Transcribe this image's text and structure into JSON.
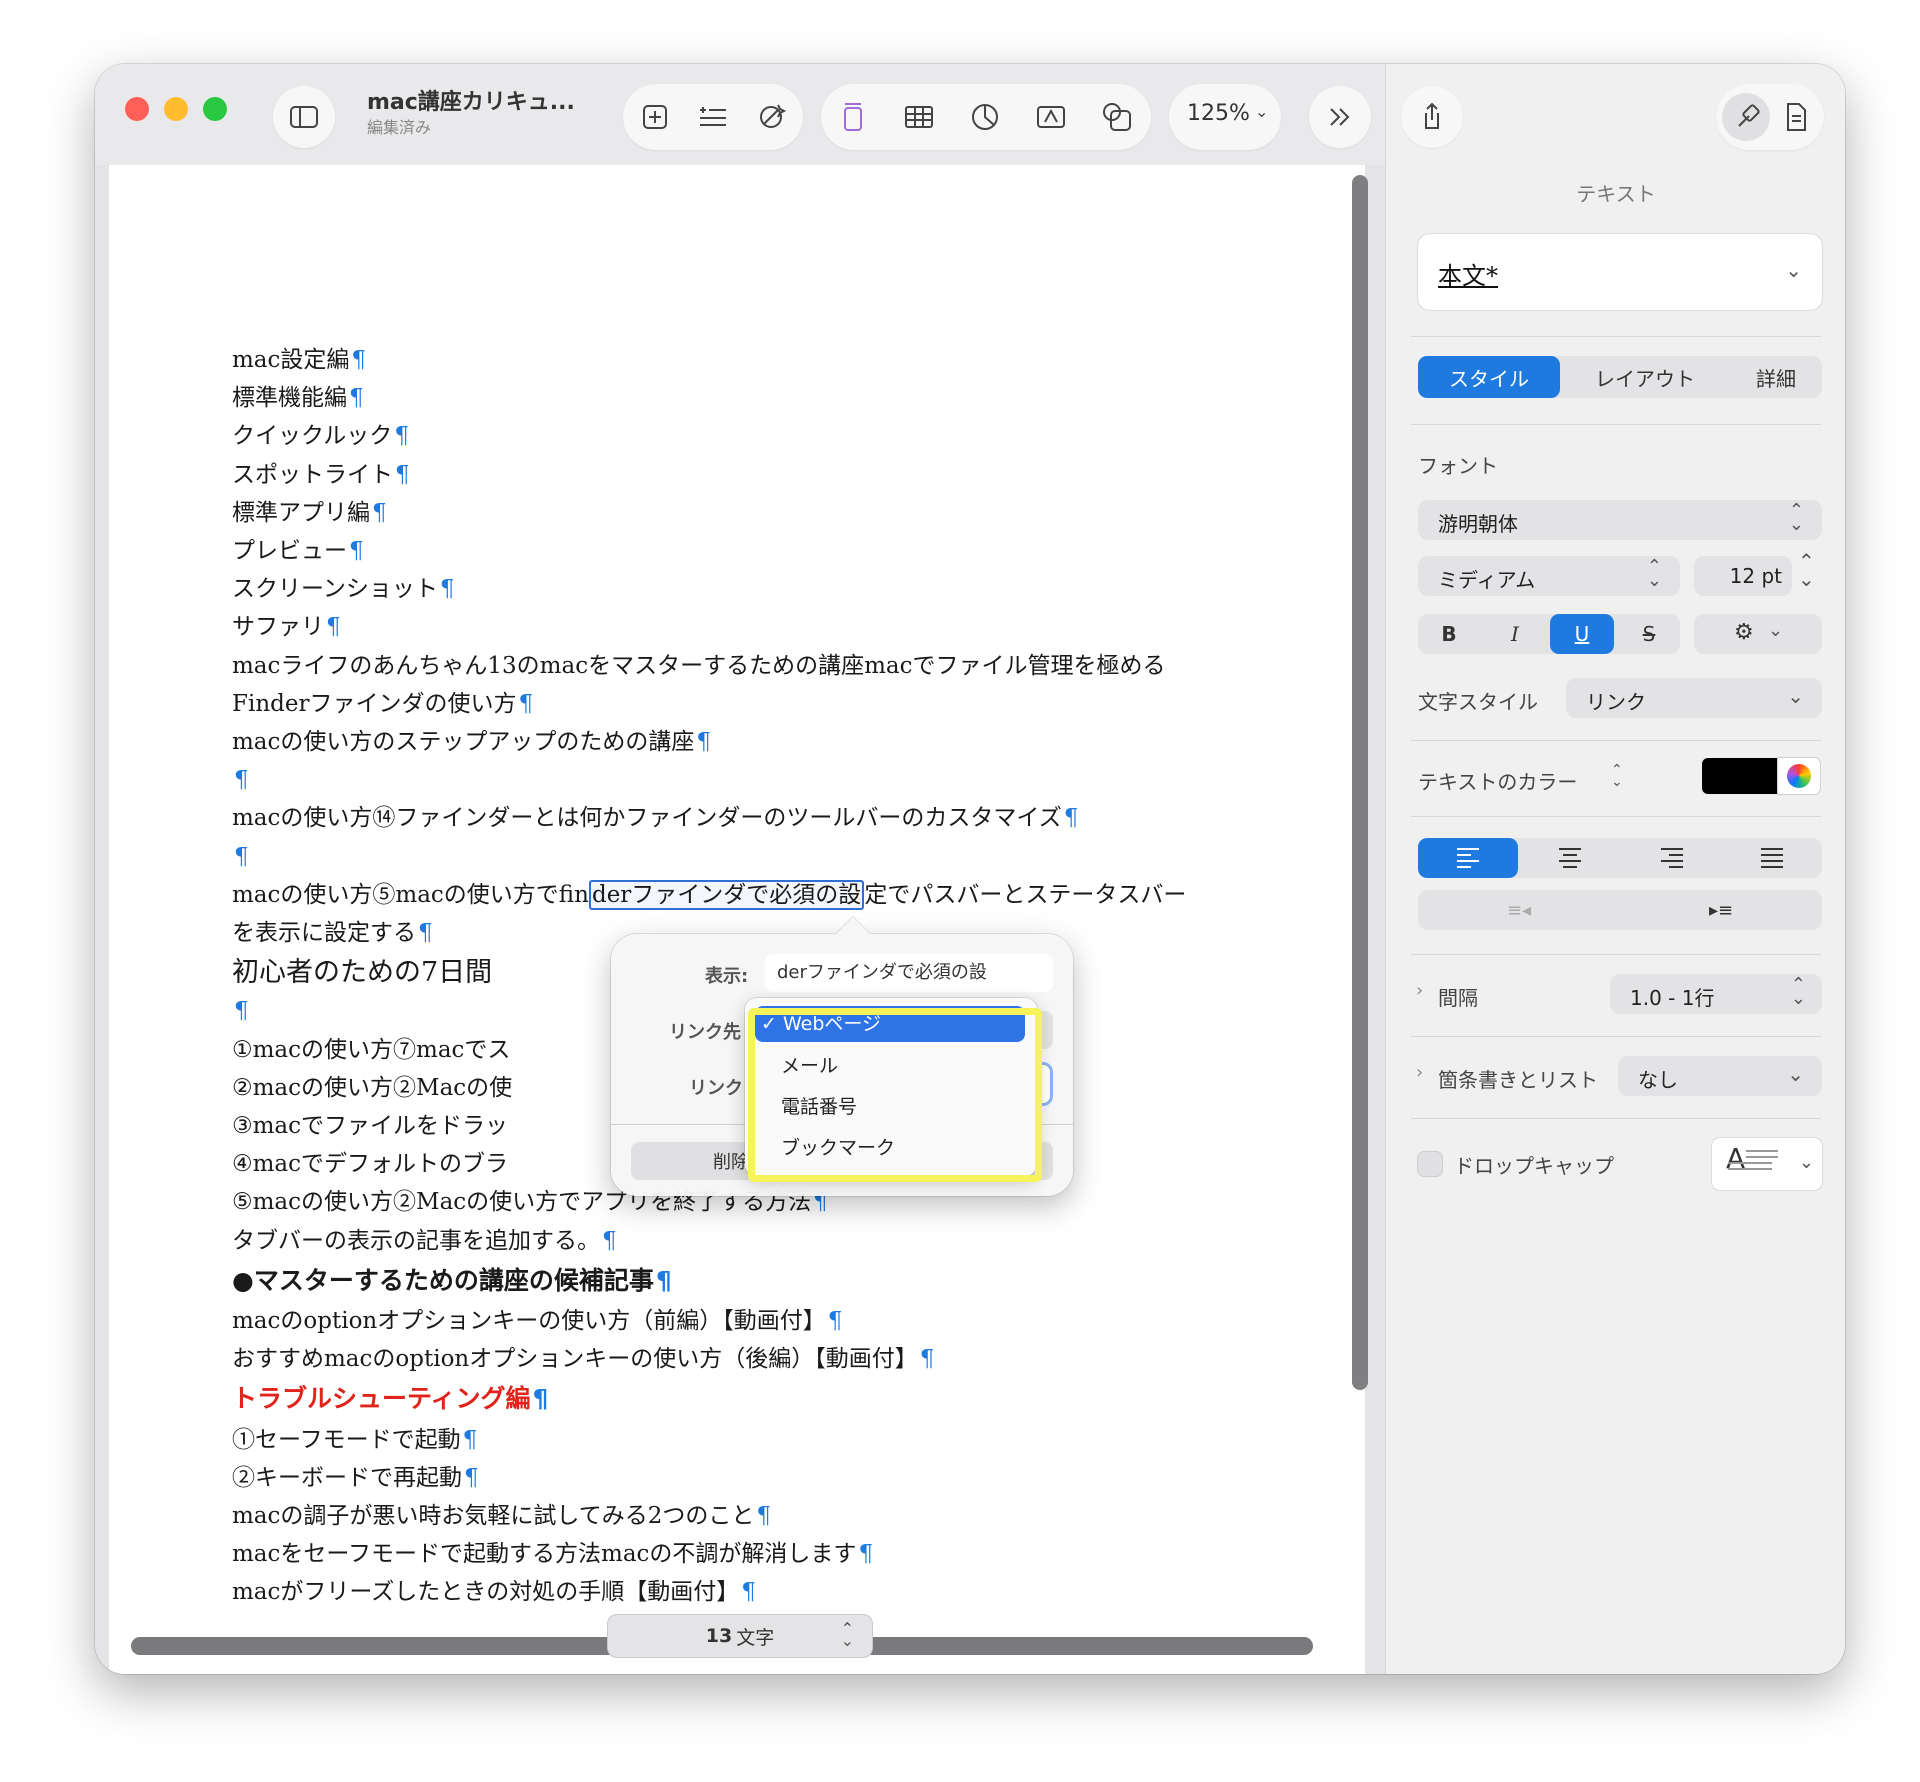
{
  "window": {
    "title": "mac講座カリキュ...",
    "subtitle": "編集済み",
    "zoom": "125%",
    "traffic_lights": {
      "close": "#ff5f57",
      "minimize": "#febc2e",
      "zoom": "#28c840"
    }
  },
  "toolbar": {
    "icons": [
      "sidebar-icon",
      "add-page-icon",
      "bullet-list-icon",
      "sparkle-icon",
      "text-box-icon",
      "table-icon",
      "chart-icon",
      "textbox-a-icon",
      "shape-icon",
      "more-chevron-icon",
      "share-icon",
      "format-brush-icon",
      "document-icon"
    ]
  },
  "document": {
    "lines": [
      "mac設定編",
      "標準機能編",
      "クイックルック",
      "スポットライト",
      "標準アプリ編",
      "プレビュー",
      "スクリーンショット",
      "サファリ",
      "macライフのあんちゃん13のmacをマスターするための講座macでファイル管理を極める",
      "Finderファインダの使い方",
      "macの使い方のステップアップのための講座",
      "",
      "macの使い方⑭ファインダーとは何かファインダーのツールバーのカスタマイズ",
      ""
    ],
    "selected_line": {
      "before": "macの使い方⑤macの使い方でfin",
      "selected": "derファインダで必須の設",
      "after": "定でパスバーとステータスバー"
    },
    "line_cont": "を表示に設定する",
    "heading_big": "初心者のための7日間",
    "lines_after_popover": [
      "",
      "①macの使い方⑦macでス",
      "②macの使い方②Macの使",
      "③macでファイルをドラッ",
      "④macでデフォルトのブラ",
      "⑤macの使い方②Macの使い方でアプリを終了する方法",
      "タブバーの表示の記事を追加する。"
    ],
    "heading_bold": "●マスターするための講座の候補記事",
    "lines_mid": [
      "macのoptionオプションキーの使い方（前編）【動画付】",
      "おすすめmacのoptionオプションキーの使い方（後編）【動画付】"
    ],
    "heading_red": "トラブルシューティング編",
    "lines_end": [
      "①セーフモードで起動",
      "②キーボードで再起動",
      "macの調子が悪い時お気軽に試してみる2つのこと",
      "macをセーフモードで起動する方法macの不調が解消します",
      "macがフリーズしたときの対処の手順【動画付】"
    ],
    "pilcrow": "¶",
    "word_count_num": "13",
    "word_count_unit": "文字"
  },
  "link_popover": {
    "display_label": "表示:",
    "display_value": "derファインダで必須の設",
    "link_to_label": "リンク先",
    "link_label": "リンク",
    "delete_label": "削除",
    "options": [
      "Webページ",
      "メール",
      "電話番号",
      "ブックマーク"
    ],
    "selected_option": "Webページ",
    "check": "✓"
  },
  "inspector": {
    "title": "テキスト",
    "paragraph_style": "本文*",
    "tabs": [
      "スタイル",
      "レイアウト",
      "詳細"
    ],
    "font_label": "フォント",
    "font_family": "游明朝体",
    "font_weight": "ミディアム",
    "font_size": "12 pt",
    "style_buttons": [
      "B",
      "I",
      "U",
      "S"
    ],
    "char_style_label": "文字スタイル",
    "char_style_value": "リンク",
    "text_color_label": "テキストのカラー",
    "text_color": "#000000",
    "spacing_label": "間隔",
    "spacing_value": "1.0 - 1行",
    "bullets_label": "箇条書きとリスト",
    "bullets_value": "なし",
    "dropcap_label": "ドロップキャップ",
    "dropcap_glyph": "A",
    "accent_color": "#1f7ae0"
  }
}
